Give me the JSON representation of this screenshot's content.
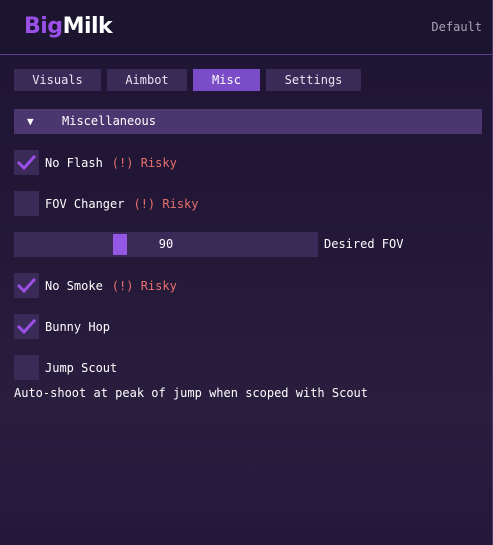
{
  "header": {
    "logo_part1": "Big",
    "logo_part2": "Milk",
    "config_label": "Default"
  },
  "tabs": [
    {
      "label": "Visuals",
      "active": false
    },
    {
      "label": "Aimbot",
      "active": false
    },
    {
      "label": "Misc",
      "active": true
    },
    {
      "label": "Settings",
      "active": false
    }
  ],
  "section": {
    "arrow": "▼",
    "title": "Miscellaneous"
  },
  "options": {
    "no_flash": {
      "label": "No Flash",
      "checked": true,
      "warning": "(!) Risky"
    },
    "fov_changer": {
      "label": "FOV Changer",
      "checked": false,
      "warning": "(!) Risky"
    },
    "no_smoke": {
      "label": "No Smoke",
      "checked": true,
      "warning": "(!) Risky"
    },
    "bunny_hop": {
      "label": "Bunny Hop",
      "checked": true
    },
    "jump_scout": {
      "label": "Jump Scout",
      "checked": false
    }
  },
  "fov_slider": {
    "value": "90",
    "fill_fraction": 0.34,
    "label": "Desired FOV"
  },
  "jump_scout_description": "Auto-shoot at peak of jump when scoped with Scout",
  "colors": {
    "accent": "#9a4fe6",
    "tab_active": "#7a4cc8",
    "frame_bg": "#3a2a57",
    "header_bg": "#4b3670",
    "risky_text": "#e8706c"
  }
}
